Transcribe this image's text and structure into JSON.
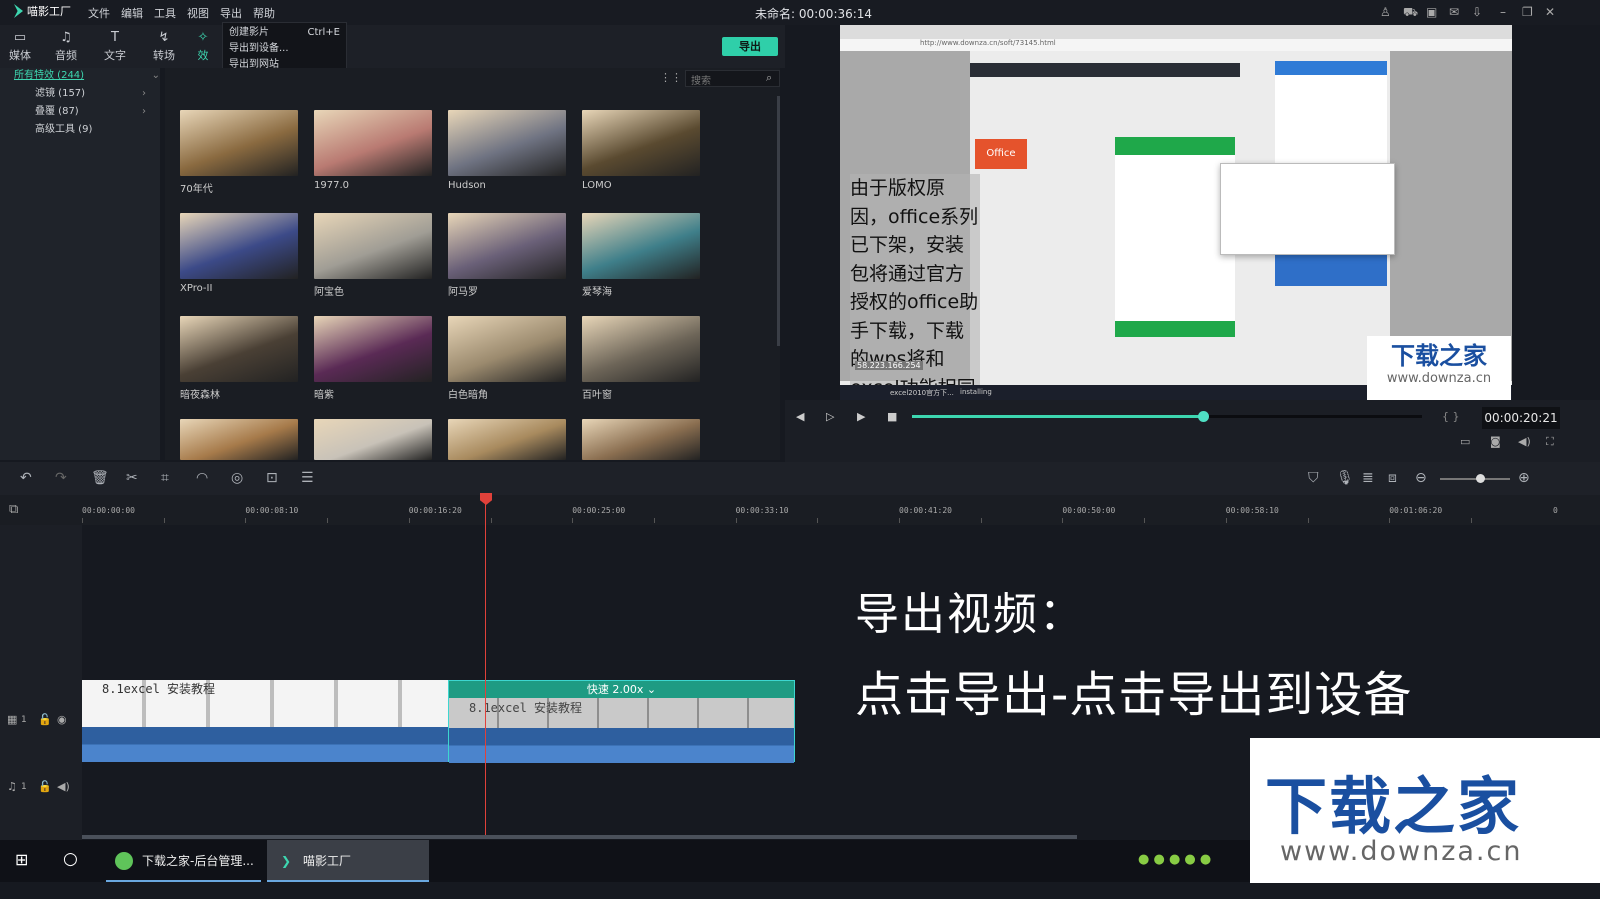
{
  "app": {
    "name": "喵影工厂",
    "title": "未命名: 00:00:36:14"
  },
  "menu": [
    "文件",
    "编辑",
    "工具",
    "视图",
    "导出",
    "帮助"
  ],
  "export_menu": [
    {
      "label": "创建影片",
      "shortcut": "Ctrl+E"
    },
    {
      "label": "导出到设备..."
    },
    {
      "label": "导出到网站"
    }
  ],
  "tabs": [
    {
      "label": "媒体",
      "icon": "folder-icon"
    },
    {
      "label": "音频",
      "icon": "music-icon"
    },
    {
      "label": "文字",
      "icon": "text-icon"
    },
    {
      "label": "转场",
      "icon": "transition-icon"
    },
    {
      "label": "效",
      "icon": "effects-icon"
    }
  ],
  "export_button": "导出",
  "sidebar": [
    {
      "label": "所有特效 (244)",
      "active": true
    },
    {
      "label": "滤镜 (157)"
    },
    {
      "label": "叠覆 (87)"
    },
    {
      "label": "高级工具 (9)"
    }
  ],
  "search": {
    "placeholder": "搜索"
  },
  "effects": [
    {
      "label": "70年代",
      "color": "#8a6a40"
    },
    {
      "label": "1977.0",
      "color": "#b97a72"
    },
    {
      "label": "Hudson",
      "color": "#6f7382"
    },
    {
      "label": "LOMO",
      "color": "#5a4a30"
    },
    {
      "label": "XPro-II",
      "color": "#3c4a88"
    },
    {
      "label": "阿宝色",
      "color": "#a09d95"
    },
    {
      "label": "阿马罗",
      "color": "#6a6078"
    },
    {
      "label": "爱琴海",
      "color": "#3f7f8a"
    },
    {
      "label": "暗夜森林",
      "color": "#4a4035"
    },
    {
      "label": "暗紫",
      "color": "#5a2a55"
    },
    {
      "label": "白色暗角",
      "color": "#9b8a6e"
    },
    {
      "label": "百叶窗",
      "color": "#6d6558"
    },
    {
      "label": "",
      "color": "#a67a4a"
    },
    {
      "label": "",
      "color": "#c8c2b8"
    },
    {
      "label": "",
      "color": "#a88a5e"
    },
    {
      "label": "",
      "color": "#8a6e50"
    }
  ],
  "preview": {
    "caption": "由于版权原因，office系列已下架，安装包将通过官方授权的office助手下载，下载的wps将和excel功能相同",
    "url": "http://www.downza.cn/soft/73145.html",
    "ip": "58.223.166.254",
    "taskbar_item": "excel2010官方下...",
    "installing": "installing",
    "logo_cn": "下载之家",
    "logo_url": "www.downza.cn",
    "timecode": "00:00:20:21",
    "progress": 0.57
  },
  "ruler": [
    "00:00:00:00",
    "00:00:08:10",
    "00:00:16:20",
    "00:00:25:00",
    "00:00:33:10",
    "00:00:41:20",
    "00:00:50:00",
    "00:00:58:10",
    "00:01:06:20",
    "0"
  ],
  "tracks": {
    "video_label": "1",
    "audio_label": "1",
    "clip1": "8.1excel 安装教程",
    "clip2": "8.1excel 安装教程",
    "speed": "快速 2.00x"
  },
  "overlay": {
    "line1": "导出视频：",
    "line2": "点击导出-点击导出到设备"
  },
  "watermark": {
    "cn": "下载之家",
    "url": "www.downza.cn"
  },
  "taskbar": [
    {
      "label": "下载之家-后台管理..."
    },
    {
      "label": "喵影工厂"
    }
  ]
}
